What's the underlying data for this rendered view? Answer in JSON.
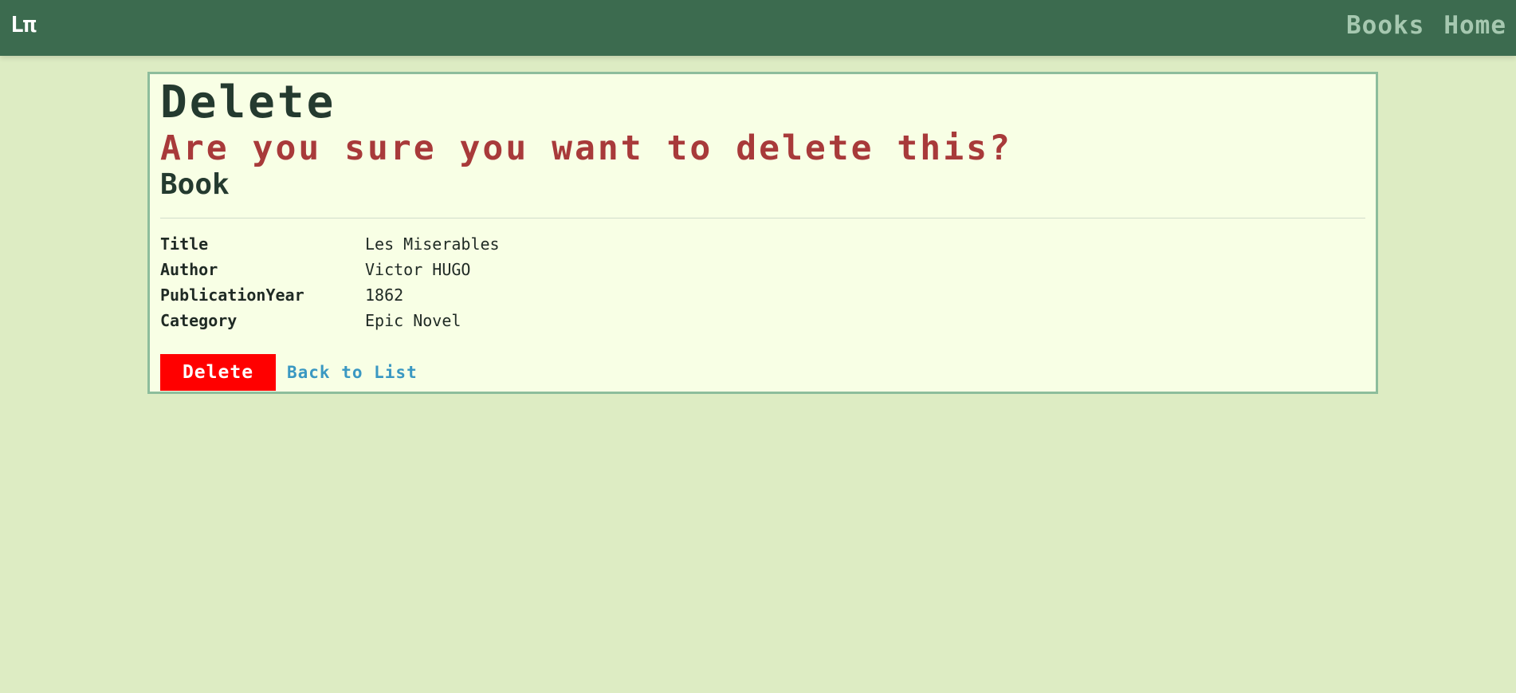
{
  "navbar": {
    "brand": "Lπ",
    "links": [
      {
        "label": "Books"
      },
      {
        "label": "Home"
      }
    ]
  },
  "page": {
    "title": "Delete",
    "confirm": "Are you sure you want to delete this?",
    "entity": "Book"
  },
  "details": [
    {
      "label": "Title",
      "value": "Les Miserables"
    },
    {
      "label": "Author",
      "value": "Victor HUGO"
    },
    {
      "label": "PublicationYear",
      "value": "1862"
    },
    {
      "label": "Category",
      "value": "Epic Novel"
    }
  ],
  "actions": {
    "delete_label": "Delete",
    "back_label": "Back to List"
  },
  "colors": {
    "navbar": "#3c6b4f",
    "background": "#ddecc3",
    "card": "#f8ffe5",
    "danger": "#ff0000",
    "confirm_text": "#a83a3a",
    "link": "#3a98c2"
  }
}
